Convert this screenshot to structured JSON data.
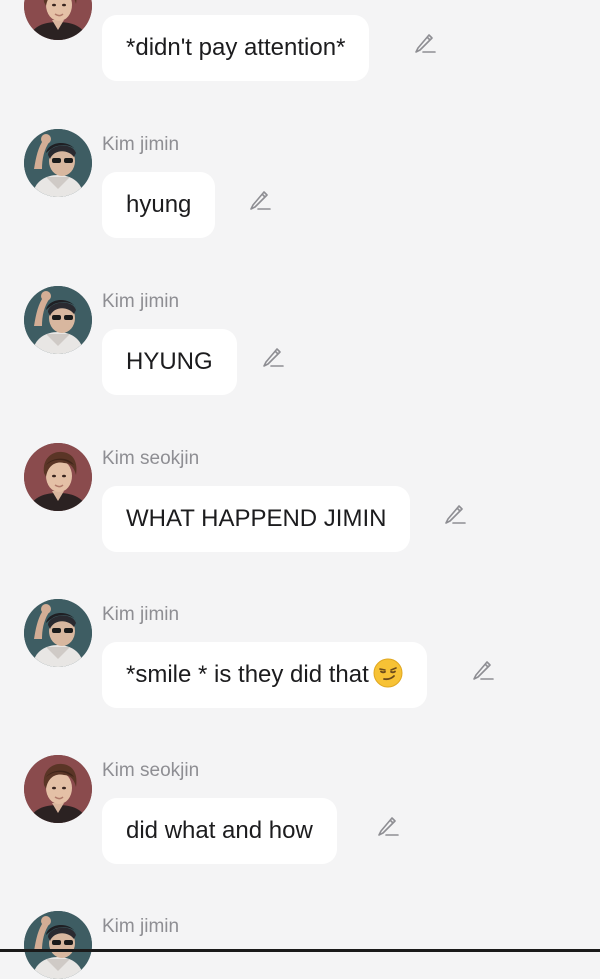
{
  "messages": [
    {
      "sender": "",
      "text": "*didn't pay attention*",
      "avatar": "jin-avatar"
    },
    {
      "sender": "Kim jimin",
      "text": "hyung",
      "avatar": "jimin-avatar"
    },
    {
      "sender": "Kim jimin",
      "text": "HYUNG",
      "avatar": "jimin-avatar"
    },
    {
      "sender": "Kim seokjin",
      "text": "WHAT HAPPEND JIMIN",
      "avatar": "jin-avatar"
    },
    {
      "sender": "Kim jimin",
      "text": "*smile * is they did that",
      "emoji": "smirking-face-emoji",
      "avatar": "jimin-avatar"
    },
    {
      "sender": "Kim seokjin",
      "text": "did what and how",
      "avatar": "jin-avatar"
    },
    {
      "sender": "Kim jimin",
      "text": "",
      "avatar": "jimin-avatar"
    }
  ],
  "icons": {
    "edit": "pencil-edit-icon"
  },
  "colors": {
    "background": "#f4f4f5",
    "bubble": "#ffffff",
    "sender_name": "#8e8e93",
    "message_text": "#1c1c1e",
    "icon": "#8e8e93"
  }
}
